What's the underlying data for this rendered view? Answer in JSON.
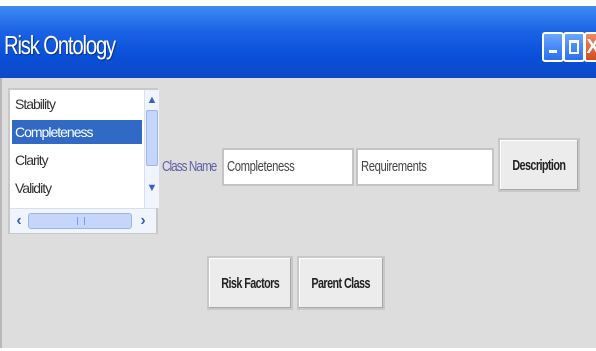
{
  "window": {
    "title": "Risk Ontology",
    "controls": {
      "minimize": "_",
      "maximize": "□",
      "close": "X"
    },
    "colors": {
      "titlebar": "#1a63e6",
      "close": "#d44a1e",
      "content_bg": "#dddddd",
      "selection": "#316ac5"
    }
  },
  "list": {
    "items": [
      "Stability",
      "Completeness",
      "Clarity",
      "Validity"
    ],
    "selected": "Completeness"
  },
  "form": {
    "class_name_label": "Class Name",
    "class_name_value": "Completeness",
    "requirement_value": "Requirements"
  },
  "buttons": {
    "description": "Description",
    "risk_factors": "Risk Factors",
    "parent_class": "Parent Class"
  }
}
